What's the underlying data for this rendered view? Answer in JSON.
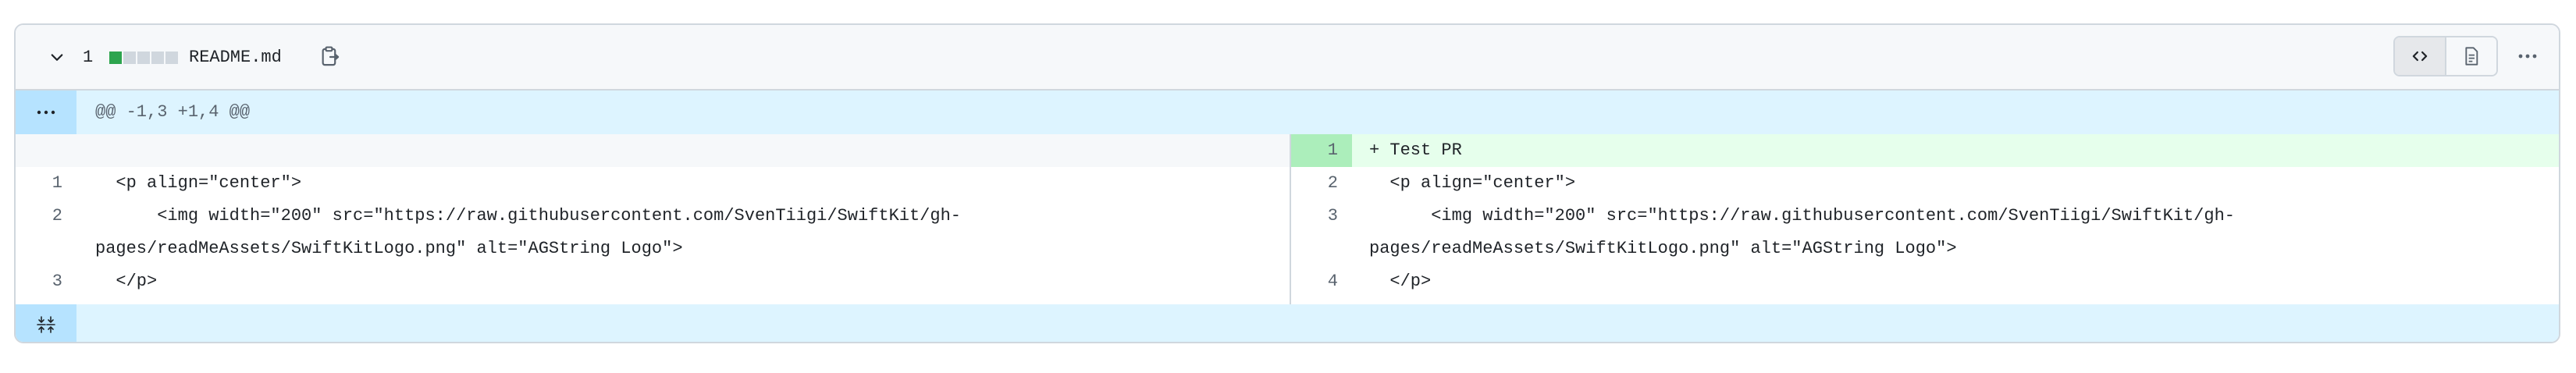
{
  "file": {
    "change_count": "1",
    "filename": "README.md",
    "diffstat": {
      "added_blocks": 1,
      "total_blocks": 5
    },
    "icons": {
      "collapse": "chevron-down-icon",
      "copy": "copy-path-icon",
      "code_view": "code-icon",
      "rich_view": "file-icon",
      "more": "kebab-horizontal-icon",
      "expand_top": "ellipsis-icon",
      "expand_bottom": "unfold-icon"
    }
  },
  "hunk": {
    "expander_label": "...",
    "header": "@@ -1,3 +1,4 @@"
  },
  "left_lines": [
    {
      "num": "1",
      "text": "  <p align=\"center\">"
    },
    {
      "num": "2",
      "text": "      <img width=\"200\" src=\"https://raw.githubusercontent.com/SvenTiigi/SwiftKit/gh-"
    },
    {
      "num": "",
      "text": "pages/readMeAssets/SwiftKitLogo.png\" alt=\"AGString Logo\">"
    },
    {
      "num": "3",
      "text": "  </p>"
    }
  ],
  "right_lines": [
    {
      "num": "1",
      "text": "+ Test PR"
    },
    {
      "num": "2",
      "text": "  <p align=\"center\">"
    },
    {
      "num": "3",
      "text": "      <img width=\"200\" src=\"https://raw.githubusercontent.com/SvenTiigi/SwiftKit/gh-"
    },
    {
      "num": "",
      "text": "pages/readMeAssets/SwiftKitLogo.png\" alt=\"AGString Logo\">"
    },
    {
      "num": "4",
      "text": "  </p>"
    }
  ],
  "colors": {
    "added_bg": "#e6ffec",
    "added_gutter": "#aceebb",
    "hunk_bg": "#ddf4ff",
    "diffstat_added": "#2da44e"
  }
}
